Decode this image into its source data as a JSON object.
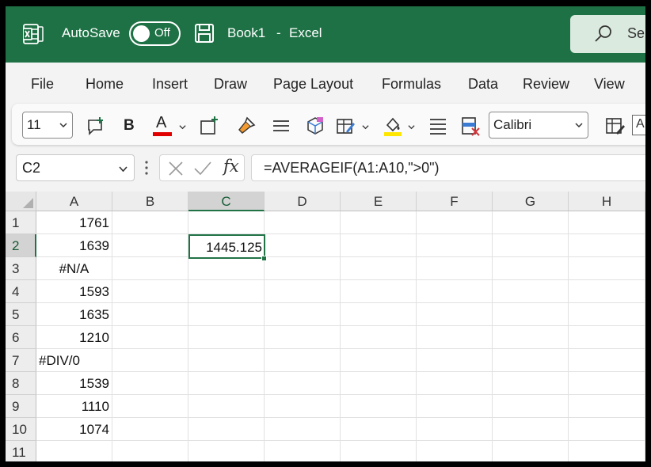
{
  "titlebar": {
    "autosave_label": "AutoSave",
    "autosave_state": "Off",
    "book_name": "Book1",
    "separator": "-",
    "app_name": "Excel",
    "search_placeholder": "Se",
    "color": "#1e7145"
  },
  "menu": {
    "items": [
      "File",
      "Home",
      "Insert",
      "Draw",
      "Page Layout",
      "Formulas",
      "Data",
      "Review",
      "View"
    ]
  },
  "ribbon": {
    "font_size": "11",
    "bold_label": "B",
    "font_color_label": "A",
    "font_name": "Calibri",
    "font_color": "#e00000",
    "highlight_color": "#ffe600",
    "icons": [
      "new-comment-icon",
      "bold-icon",
      "font-color-icon",
      "insert-cells-icon",
      "format-painter-icon",
      "align-icon",
      "3d-model-icon",
      "format-table-icon",
      "fill-color-icon",
      "justify-icon",
      "clear-icon",
      "format-as-table-icon"
    ]
  },
  "formulabar": {
    "name_box": "C2",
    "fx_label": "fx",
    "formula": "=AVERAGEIF(A1:A10,\">0\")"
  },
  "grid": {
    "columns": [
      "A",
      "B",
      "C",
      "D",
      "E",
      "F",
      "G",
      "H"
    ],
    "rows": [
      "1",
      "2",
      "3",
      "4",
      "5",
      "6",
      "7",
      "8",
      "9",
      "10",
      "11"
    ],
    "col_a": [
      "1761",
      "1639",
      "#N/A",
      "1593",
      "1635",
      "1210",
      "#DIV/0",
      "1539",
      "1110",
      "1074",
      ""
    ],
    "active_cell_value": "1445.125",
    "selected_column": "C",
    "selected_row": "2",
    "accent_color": "#217346"
  }
}
